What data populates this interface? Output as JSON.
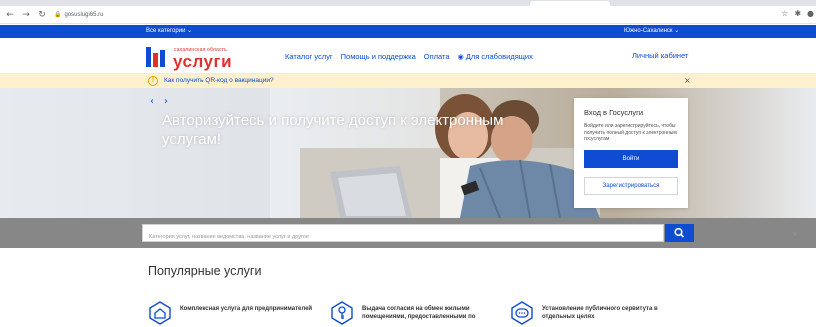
{
  "browser": {
    "url": "gosuslugi65.ru"
  },
  "topbar": {
    "categories": "Все категории ⌄",
    "region": "Южно-Сахалинск ⌄"
  },
  "header": {
    "logo_sub": "сахалинская область",
    "logo_main": "услуги",
    "nav": [
      "Каталог услуг",
      "Помощь и поддержка",
      "Оплата",
      "Для слабовидящих"
    ],
    "cabinet": "Личный кабинет"
  },
  "alert": {
    "text": "Как получить QR-код о вакцинации?"
  },
  "hero": {
    "title": "Авторизуйтесь и получите доступ к электронным услугам!"
  },
  "login": {
    "title": "Вход в Госуслуги",
    "desc": "Войдите или зарегистрируйтесь, чтобы получить полный доступ к электронным госуслугам",
    "login_label": "Войти",
    "register_label": "Зарегистрироваться"
  },
  "search": {
    "placeholder": "Категория услуг, название ведомства, название услуг и другое"
  },
  "popular": {
    "title": "Популярные услуги",
    "items": [
      {
        "label": "Комплексная услуга для предпринимателей",
        "icon": "house-icon"
      },
      {
        "label": "Выдача согласия на обмен жилыми помещениями, предоставленными по",
        "icon": "key-icon"
      },
      {
        "label": "Установление публичного сервитута в отдельных целях",
        "icon": "chat-icon"
      }
    ]
  },
  "colors": {
    "primary": "#0d4cd3",
    "logo_red": "#e0322c",
    "alert_bg": "#fdf0cd",
    "search_strip": "#878787"
  }
}
